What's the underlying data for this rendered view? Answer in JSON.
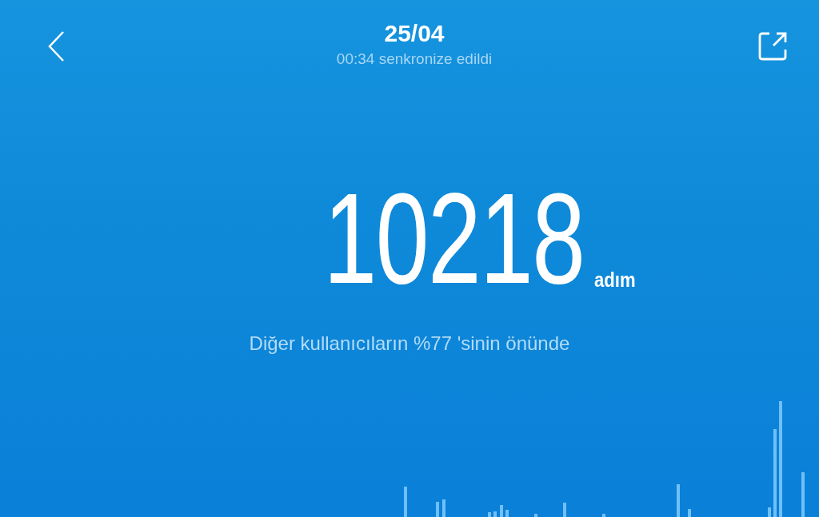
{
  "header": {
    "title": "25/04",
    "subtitle": "00:34 senkronize edildi"
  },
  "steps": {
    "value": "10218",
    "unit": "adım"
  },
  "ranking": "Diğer kullanıcıların %77 'sinin önünde"
}
